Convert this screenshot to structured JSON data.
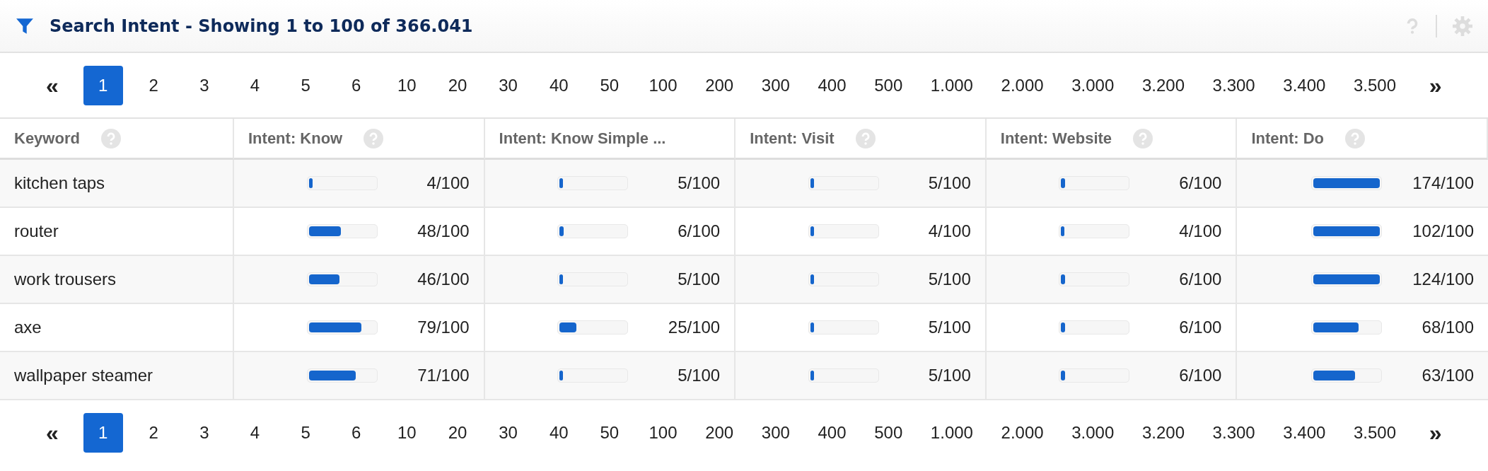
{
  "panel": {
    "title": "Search Intent - Showing 1 to 100 of 366.041"
  },
  "pagination_top": {
    "first": "«",
    "last": "»",
    "pages": [
      {
        "label": "1",
        "selected": true
      },
      {
        "label": "2",
        "selected": false
      },
      {
        "label": "3",
        "selected": false
      },
      {
        "label": "4",
        "selected": false
      },
      {
        "label": "5",
        "selected": false
      },
      {
        "label": "6",
        "selected": false
      },
      {
        "label": "10",
        "selected": false
      },
      {
        "label": "20",
        "selected": false
      },
      {
        "label": "30",
        "selected": false
      },
      {
        "label": "40",
        "selected": false
      },
      {
        "label": "50",
        "selected": false
      },
      {
        "label": "100",
        "selected": false
      },
      {
        "label": "200",
        "selected": false
      },
      {
        "label": "300",
        "selected": false
      },
      {
        "label": "400",
        "selected": false
      },
      {
        "label": "500",
        "selected": false
      },
      {
        "label": "1.000",
        "selected": false
      },
      {
        "label": "2.000",
        "selected": false
      },
      {
        "label": "3.000",
        "selected": false
      },
      {
        "label": "3.200",
        "selected": false
      },
      {
        "label": "3.300",
        "selected": false
      },
      {
        "label": "3.400",
        "selected": false
      },
      {
        "label": "3.500",
        "selected": false
      }
    ]
  },
  "table": {
    "columns": [
      {
        "label": "Keyword",
        "help": true
      },
      {
        "label": "Intent: Know",
        "help": true
      },
      {
        "label": "Intent: Know Simple ...",
        "help": false
      },
      {
        "label": "Intent: Visit",
        "help": true
      },
      {
        "label": "Intent: Website",
        "help": true
      },
      {
        "label": "Intent: Do",
        "help": true
      }
    ],
    "rows": [
      {
        "keyword": "kitchen taps",
        "scores": [
          {
            "level": 0.04,
            "reading": "4/100"
          },
          {
            "level": 0.05,
            "reading": "5/100"
          },
          {
            "level": 0.05,
            "reading": "5/100"
          },
          {
            "level": 0.06,
            "reading": "6/100"
          },
          {
            "level": 1,
            "reading": "174/100"
          }
        ]
      },
      {
        "keyword": "router",
        "scores": [
          {
            "level": 0.48,
            "reading": "48/100"
          },
          {
            "level": 0.06,
            "reading": "6/100"
          },
          {
            "level": 0.04,
            "reading": "4/100"
          },
          {
            "level": 0.04,
            "reading": "4/100"
          },
          {
            "level": 1,
            "reading": "102/100"
          }
        ]
      },
      {
        "keyword": "work trousers",
        "scores": [
          {
            "level": 0.46,
            "reading": "46/100"
          },
          {
            "level": 0.05,
            "reading": "5/100"
          },
          {
            "level": 0.05,
            "reading": "5/100"
          },
          {
            "level": 0.06,
            "reading": "6/100"
          },
          {
            "level": 1,
            "reading": "124/100"
          }
        ]
      },
      {
        "keyword": "axe",
        "scores": [
          {
            "level": 0.79,
            "reading": "79/100"
          },
          {
            "level": 0.25,
            "reading": "25/100"
          },
          {
            "level": 0.05,
            "reading": "5/100"
          },
          {
            "level": 0.06,
            "reading": "6/100"
          },
          {
            "level": 0.68,
            "reading": "68/100"
          }
        ]
      },
      {
        "keyword": "wallpaper steamer",
        "scores": [
          {
            "level": 0.71,
            "reading": "71/100"
          },
          {
            "level": 0.05,
            "reading": "5/100"
          },
          {
            "level": 0.05,
            "reading": "5/100"
          },
          {
            "level": 0.06,
            "reading": "6/100"
          },
          {
            "level": 0.63,
            "reading": "63/100"
          }
        ]
      }
    ]
  },
  "pagination_bottom": {
    "first": "«",
    "last": "»",
    "pages": [
      {
        "label": "1",
        "selected": true
      },
      {
        "label": "2",
        "selected": false
      },
      {
        "label": "3",
        "selected": false
      },
      {
        "label": "4",
        "selected": false
      },
      {
        "label": "5",
        "selected": false
      },
      {
        "label": "6",
        "selected": false
      },
      {
        "label": "10",
        "selected": false
      },
      {
        "label": "20",
        "selected": false
      },
      {
        "label": "30",
        "selected": false
      },
      {
        "label": "40",
        "selected": false
      },
      {
        "label": "50",
        "selected": false
      },
      {
        "label": "100",
        "selected": false
      },
      {
        "label": "200",
        "selected": false
      },
      {
        "label": "300",
        "selected": false
      },
      {
        "label": "400",
        "selected": false
      },
      {
        "label": "500",
        "selected": false
      },
      {
        "label": "1.000",
        "selected": false
      },
      {
        "label": "2.000",
        "selected": false
      },
      {
        "label": "3.000",
        "selected": false
      },
      {
        "label": "3.200",
        "selected": false
      },
      {
        "label": "3.300",
        "selected": false
      },
      {
        "label": "3.400",
        "selected": false
      },
      {
        "label": "3.500",
        "selected": false
      }
    ]
  }
}
